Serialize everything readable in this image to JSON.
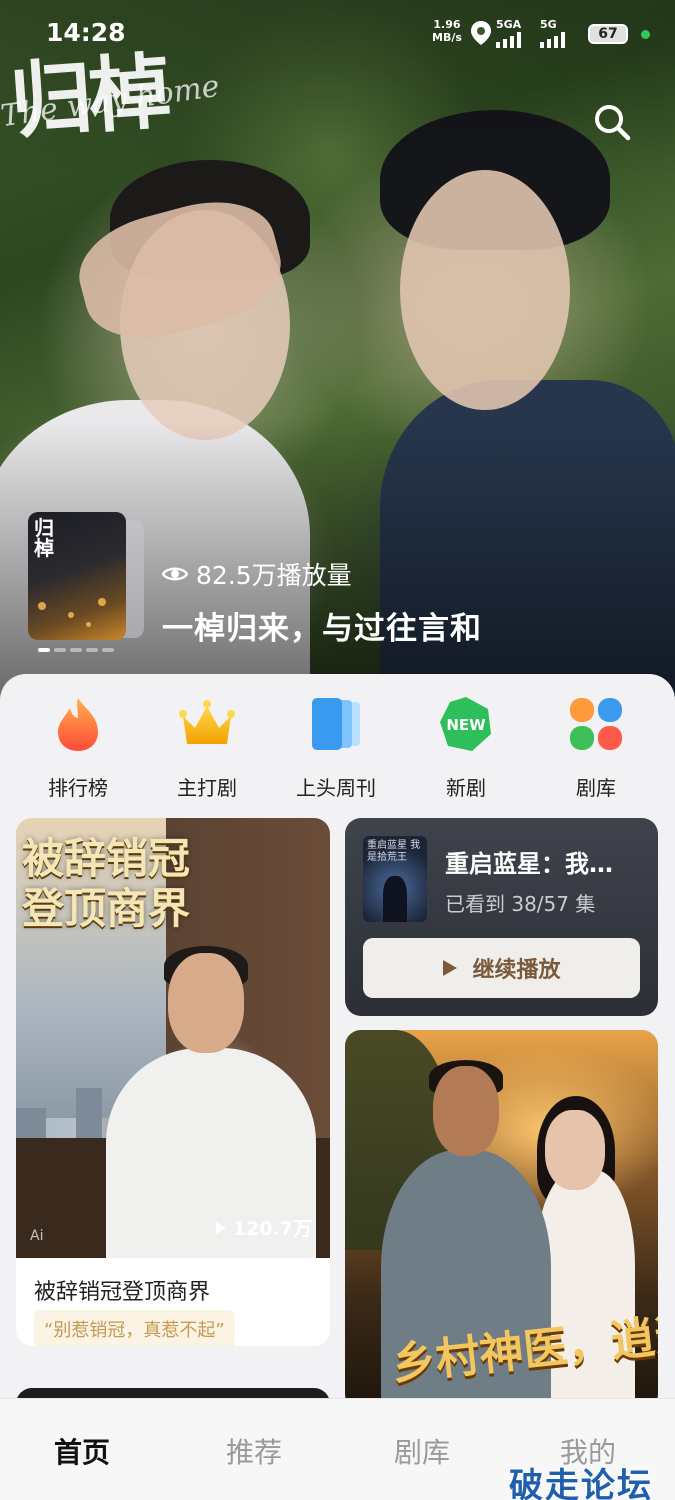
{
  "status_bar": {
    "time": "14:28",
    "net_speed_value": "1.96",
    "net_speed_unit": "MB/s",
    "sim1_label": "5GA",
    "sim2_label": "5G",
    "battery": "67"
  },
  "hero": {
    "logo_text": "归棹",
    "logo_script": "The way home",
    "mini_poster_title": "归棹",
    "views": "82.5万播放量",
    "tagline": "一棹归来，与过往言和",
    "carousel_count": 5,
    "carousel_active": 0
  },
  "quick_nav": [
    {
      "label": "排行榜",
      "icon": "flame-icon"
    },
    {
      "label": "主打剧",
      "icon": "crown-icon"
    },
    {
      "label": "上头周刊",
      "icon": "stacked-cards-icon"
    },
    {
      "label": "新剧",
      "icon": "new-badge-icon",
      "badge": "NEW"
    },
    {
      "label": "剧库",
      "icon": "four-petal-icon"
    }
  ],
  "featured_left": {
    "poster_title": "被辞销冠登顶商界",
    "poster_title_line1": "被辞销冠",
    "poster_title_line2": "登顶商界",
    "ai_mark": "Ai",
    "play_count": "120.7万",
    "title": "被辞销冠登顶商界",
    "tag": "“别惹销冠，真惹不起”"
  },
  "continue_watching": {
    "thumb_text": "重启蓝星 我是拾荒王",
    "title": "重启蓝星：我是拾荒王",
    "progress": "已看到 38/57 集",
    "button_label": "继续播放"
  },
  "featured_right": {
    "poster_text": "乡村神医，逍遥花都"
  },
  "tabs": [
    {
      "label": "首页",
      "active": true
    },
    {
      "label": "推荐",
      "active": false
    },
    {
      "label": "剧库",
      "active": false
    },
    {
      "label": "我的",
      "active": false
    }
  ],
  "watermark": "破走论坛",
  "colors": {
    "accent_brown": "#7a5a3a",
    "tag_text": "#c59a52",
    "tag_bg": "#fbf3e4",
    "watermark": "#1f5fae"
  }
}
